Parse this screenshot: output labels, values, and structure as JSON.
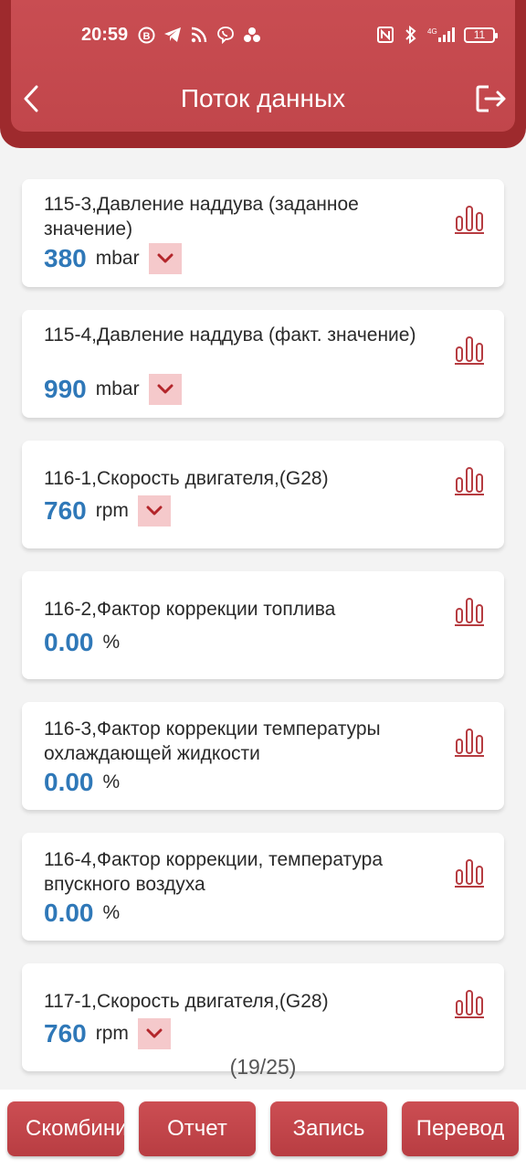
{
  "status_bar": {
    "time": "20:59",
    "battery": "11",
    "icons_left": [
      "b-icon",
      "telegram-icon",
      "rss-icon",
      "viber-icon",
      "dots-icon"
    ],
    "icons_right": [
      "nfc-icon",
      "bluetooth-icon",
      "signal-icon"
    ]
  },
  "header": {
    "title": "Поток данных"
  },
  "items": [
    {
      "label": "115-3,Давление наддува (заданное значение)",
      "value": "380",
      "unit": "mbar",
      "has_dropdown": true
    },
    {
      "label": "115-4,Давление наддува (факт. значение)",
      "value": "990",
      "unit": "mbar",
      "has_dropdown": true
    },
    {
      "label": "116-1,Скорость двигателя,(G28)",
      "value": "760",
      "unit": "rpm",
      "has_dropdown": true
    },
    {
      "label": "116-2,Фактор коррекции топлива",
      "value": "0.00",
      "unit": "%",
      "has_dropdown": false
    },
    {
      "label": "116-3,Фактор коррекции температуры охлаждающей жидкости",
      "value": "0.00",
      "unit": "%",
      "has_dropdown": false
    },
    {
      "label": "116-4,Фактор коррекции, температура впускного воздуха",
      "value": "0.00",
      "unit": "%",
      "has_dropdown": false
    },
    {
      "label": "117-1,Скорость двигателя,(G28)",
      "value": "760",
      "unit": "rpm",
      "has_dropdown": true
    }
  ],
  "page_counter": "(19/25)",
  "bottom_buttons": {
    "combine": "Скомбинировать",
    "report": "Отчет",
    "record": "Запись",
    "translate": "Перевод"
  },
  "colors": {
    "header": "#c1464b",
    "value": "#2f78b8",
    "accent": "#b63c41"
  }
}
